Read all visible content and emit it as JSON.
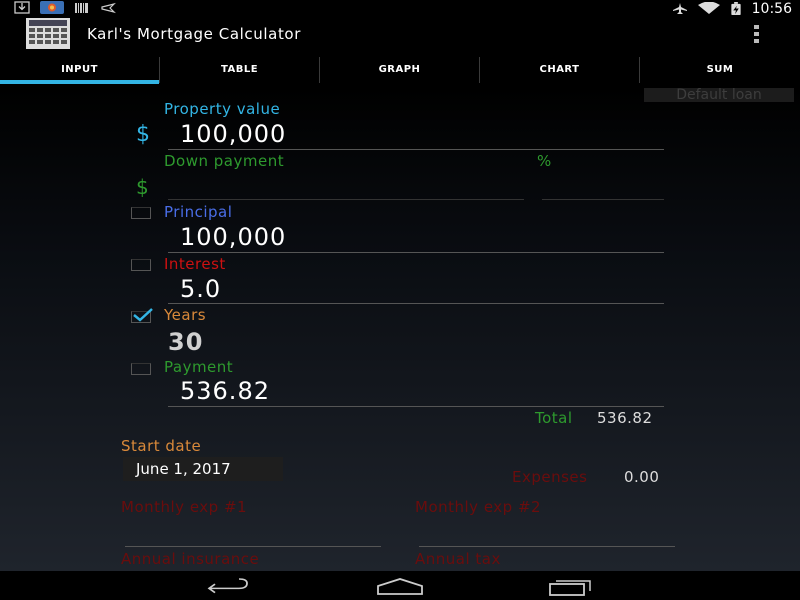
{
  "status_bar": {
    "time": "10:56"
  },
  "app": {
    "title": "Karl's Mortgage Calculator"
  },
  "tabs": [
    {
      "label": "INPUT"
    },
    {
      "label": "TABLE"
    },
    {
      "label": "GRAPH"
    },
    {
      "label": "CHART"
    },
    {
      "label": "SUM"
    }
  ],
  "form": {
    "default_loan_label": "Default loan",
    "property_value": {
      "label": "Property value",
      "currency": "$",
      "value": "100,000"
    },
    "down_payment": {
      "label": "Down payment",
      "currency": "$",
      "percent_label": "%",
      "value": "",
      "percent_value": ""
    },
    "principal": {
      "label": "Principal",
      "value": "100,000",
      "checked": false
    },
    "interest": {
      "label": "Interest",
      "value": "5.0",
      "checked": false
    },
    "years": {
      "label": "Years",
      "value": "30",
      "checked": true
    },
    "payment": {
      "label": "Payment",
      "value": "536.82",
      "checked": false
    },
    "total": {
      "label": "Total",
      "value": "536.82"
    },
    "start_date": {
      "label": "Start date",
      "value": "June 1, 2017"
    },
    "expenses": {
      "label": "Expenses",
      "value": "0.00"
    },
    "monthly_exp_1": {
      "label": "Monthly exp #1",
      "value": ""
    },
    "monthly_exp_2": {
      "label": "Monthly exp #2",
      "value": ""
    },
    "annual_insurance": {
      "label": "Annual insurance"
    },
    "annual_tax": {
      "label": "Annual tax"
    }
  },
  "colors": {
    "accent_blue": "#33b5e5",
    "green": "#2e9a2e",
    "blue_label": "#4a6ee8",
    "red": "#cc1111",
    "orange": "#d9893a"
  }
}
